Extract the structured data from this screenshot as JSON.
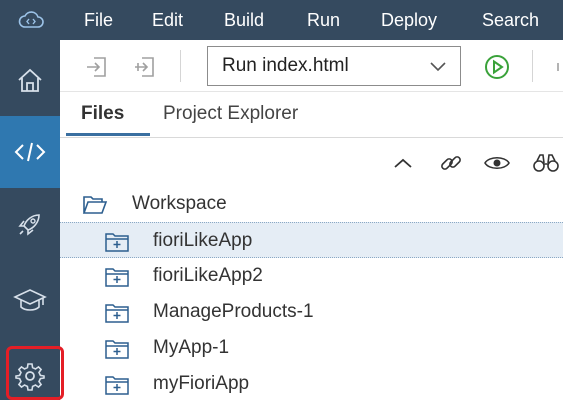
{
  "menubar": {
    "items": [
      "File",
      "Edit",
      "Build",
      "Run",
      "Deploy",
      "Search"
    ]
  },
  "toolbar": {
    "run_config": "Run index.html"
  },
  "tabs": {
    "files": "Files",
    "project_explorer": "Project Explorer"
  },
  "tree": {
    "root": "Workspace",
    "items": [
      "fioriLikeApp",
      "fioriLikeApp2",
      "ManageProducts-1",
      "MyApp-1",
      "myFioriApp"
    ]
  },
  "icons": {
    "logo": "cloud-code-icon",
    "rail": [
      "home-icon",
      "code-icon",
      "rocket-icon",
      "graduation-cap-icon",
      "gear-icon"
    ],
    "toolbar": [
      "import-icon",
      "export-icon",
      "run-icon"
    ],
    "explorer": [
      "collapse-icon",
      "link-icon",
      "eye-icon",
      "binoculars-icon"
    ]
  },
  "colors": {
    "shell": "#354a5f",
    "rail_active": "#2f78b0",
    "highlight_box": "#e41e26",
    "run_green": "#3aa23a",
    "selected_row": "#e5edf5"
  }
}
